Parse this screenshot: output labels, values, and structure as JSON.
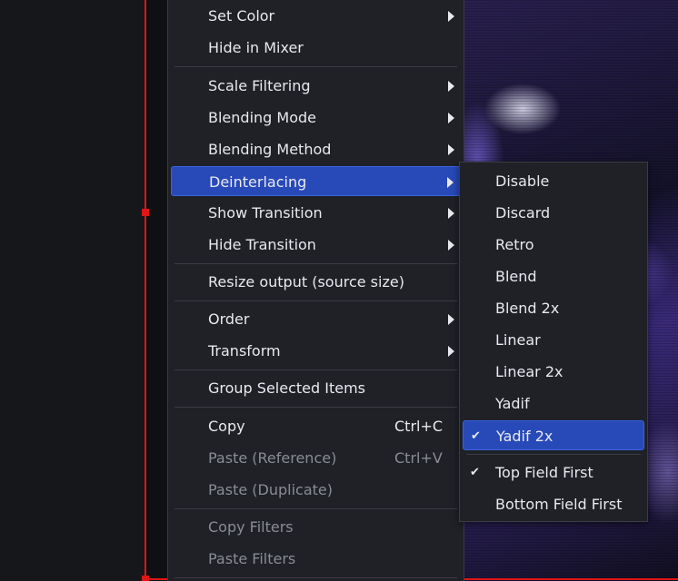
{
  "context_menu": {
    "items": [
      {
        "label": "Set Color",
        "submenu": true
      },
      {
        "label": "Hide in Mixer"
      },
      {
        "label": "Scale Filtering",
        "submenu": true
      },
      {
        "label": "Blending Mode",
        "submenu": true
      },
      {
        "label": "Blending Method",
        "submenu": true
      },
      {
        "label": "Deinterlacing",
        "submenu": true,
        "highlighted": true
      },
      {
        "label": "Show Transition",
        "submenu": true
      },
      {
        "label": "Hide Transition",
        "submenu": true
      },
      {
        "label": "Resize output (source size)"
      },
      {
        "label": "Order",
        "submenu": true
      },
      {
        "label": "Transform",
        "submenu": true
      },
      {
        "label": "Group Selected Items"
      },
      {
        "label": "Copy",
        "shortcut": "Ctrl+C"
      },
      {
        "label": "Paste (Reference)",
        "shortcut": "Ctrl+V",
        "disabled": true
      },
      {
        "label": "Paste (Duplicate)",
        "disabled": true
      },
      {
        "label": "Copy Filters",
        "disabled": true
      },
      {
        "label": "Paste Filters",
        "disabled": true
      }
    ]
  },
  "deinterlacing_submenu": {
    "items": [
      {
        "label": "Disable"
      },
      {
        "label": "Discard"
      },
      {
        "label": "Retro"
      },
      {
        "label": "Blend"
      },
      {
        "label": "Blend 2x"
      },
      {
        "label": "Linear"
      },
      {
        "label": "Linear 2x"
      },
      {
        "label": "Yadif"
      },
      {
        "label": "Yadif 2x",
        "checked": true,
        "highlighted": true
      },
      {
        "label": "Top Field First",
        "checked": true
      },
      {
        "label": "Bottom Field First"
      }
    ]
  },
  "icons": {
    "check": "✔",
    "submenu_arrow": "triangle-right"
  },
  "colors": {
    "menu_bg": "#1f2127",
    "highlight": "#284ab8",
    "selection_bounds": "#e01515",
    "text": "#e8e9ee",
    "disabled_text": "#8a8c94"
  }
}
